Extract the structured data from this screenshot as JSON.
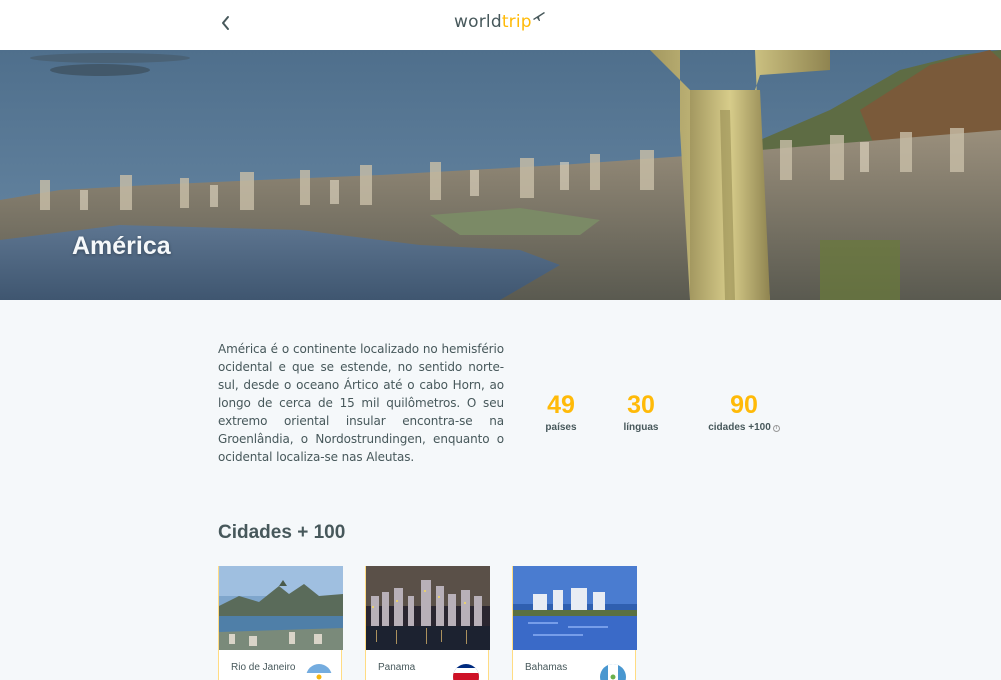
{
  "header": {
    "logo_world": "world",
    "logo_trip": "trip",
    "back_icon": "chevron-left-icon"
  },
  "banner": {
    "title": "América"
  },
  "continent": {
    "description": "América é o continente localizado no hemisfério ocidental e que se estende, no sentido norte-sul, desde o oceano Ártico até o cabo Horn, ao longo de cerca de 15 mil quilômetros. O seu extremo oriental insular encontra-se na Groenlândia, o Nordostrundingen, enquanto o ocidental localiza-se nas Aleutas."
  },
  "stats": [
    {
      "value": "49",
      "label": "países"
    },
    {
      "value": "30",
      "label": "línguas"
    },
    {
      "value": "90",
      "label": "cidades +100"
    }
  ],
  "cities_section": {
    "title": "Cidades + 100"
  },
  "cities": [
    {
      "name": "Rio de Janeiro"
    },
    {
      "name": "Panama"
    },
    {
      "name": "Bahamas"
    }
  ],
  "colors": {
    "accent": "#ffba08",
    "text": "#47585b",
    "background": "#f5f8fa"
  }
}
